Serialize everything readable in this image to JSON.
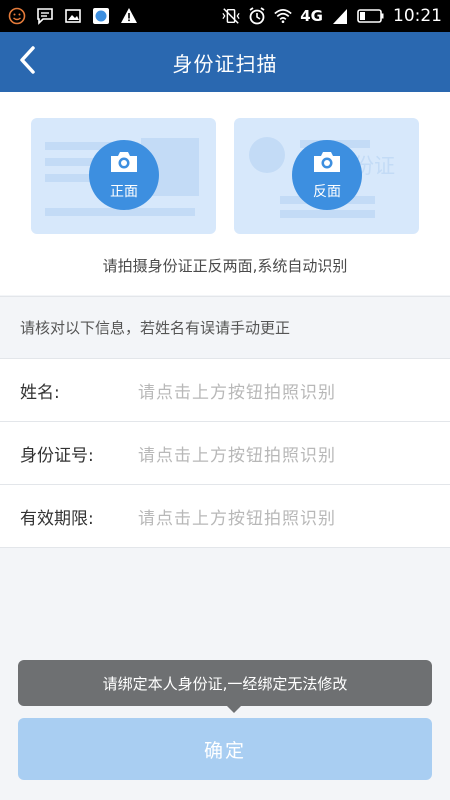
{
  "status_bar": {
    "network": "4G",
    "time": "10:21"
  },
  "nav": {
    "title": "身份证扫描"
  },
  "cards": {
    "front_label": "正面",
    "back_label": "反面",
    "back_watermark": "身份证"
  },
  "hint": "请拍摄身份证正反两面,系统自动识别",
  "info_note": "请核对以下信息，若姓名有误请手动更正",
  "form": {
    "rows": [
      {
        "label": "姓名:",
        "value": "请点击上方按钮拍照识别"
      },
      {
        "label": "身份证号:",
        "value": "请点击上方按钮拍照识别"
      },
      {
        "label": "有效期限:",
        "value": "请点击上方按钮拍照识别"
      }
    ]
  },
  "toast": "请绑定本人身份证,一经绑定无法修改",
  "confirm_label": "确定",
  "colors": {
    "nav": "#2a68b0",
    "card": "#d7e8fb",
    "camera_button": "#3d8fe0",
    "confirm_disabled": "#a9cef2"
  }
}
